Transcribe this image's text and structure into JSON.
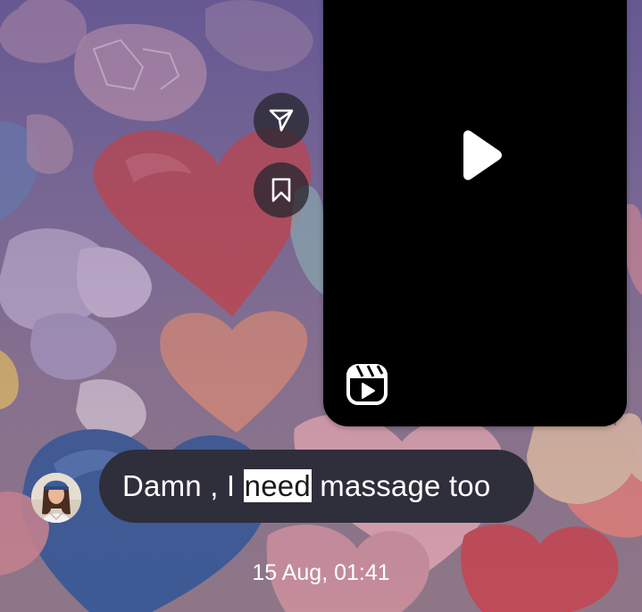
{
  "reel": {
    "play_icon": "play-icon",
    "reels_icon": "reels-icon"
  },
  "actions": {
    "share_icon": "send-icon",
    "save_icon": "bookmark-icon"
  },
  "message": {
    "text_before": "Damn , I ",
    "highlighted_word": "need",
    "text_after": " massage too",
    "bubble_color": "#2f2e3b",
    "avatar": "avatar"
  },
  "timestamp": "15 Aug, 01:41"
}
